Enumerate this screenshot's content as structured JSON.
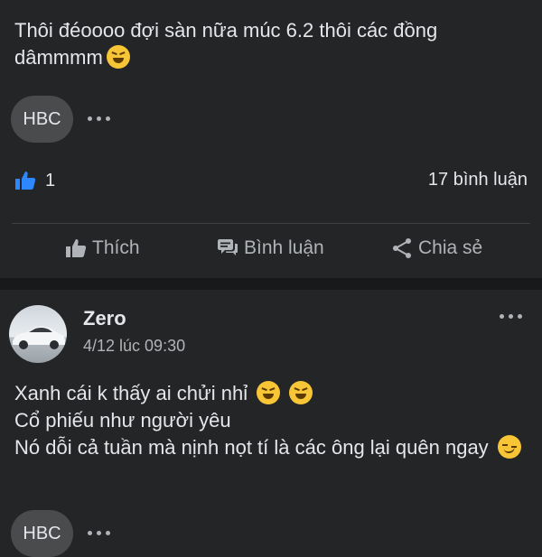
{
  "post1": {
    "text": "Thôi đéoooo đợi sàn nữa múc 6.2 thôi các đồng dâmmmm",
    "tag_chip": "HBC",
    "reaction_count": "1",
    "comment_count": "17 bình luận",
    "actions": {
      "like_label": "Thích",
      "comment_label": "Bình luận",
      "share_label": "Chia sẻ"
    }
  },
  "post2": {
    "author": "Zero",
    "timestamp": "4/12 lúc 09:30",
    "lines": [
      "Xanh cái k thấy ai chửi nhỉ",
      "Cổ phiếu như người yêu",
      "Nó dỗi cả tuần mà nịnh nọt tí là các ông lại quên ngay"
    ],
    "tag_chip": "HBC"
  },
  "icons": [
    "laughing-emoji-icon",
    "thumbs-up-icon",
    "comment-icon",
    "share-icon",
    "more-icon",
    "woozy-emoji-icon"
  ],
  "colors": {
    "background": "#242526",
    "separator": "#18191a",
    "chip": "#4a4b4d",
    "accent_blue": "#2d88ff",
    "text": "#e4e6eb",
    "muted": "#b0b3b8"
  }
}
